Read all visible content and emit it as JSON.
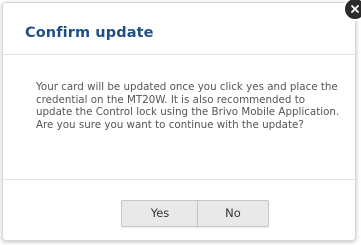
{
  "dialog": {
    "title": "Confirm update",
    "message": "Your card will be updated once you click yes and place the credential on the MT20W. It is also recommended to update the Control lock using the Brivo Mobile Application. Are you sure you want to continue with the update?",
    "yes_label": "Yes",
    "no_label": "No",
    "close_icon": "close-icon"
  },
  "colors": {
    "title": "#1f4f87",
    "body_text": "#555555",
    "button_bg": "#e9e9e9",
    "close_bg": "#2b2b2b"
  }
}
